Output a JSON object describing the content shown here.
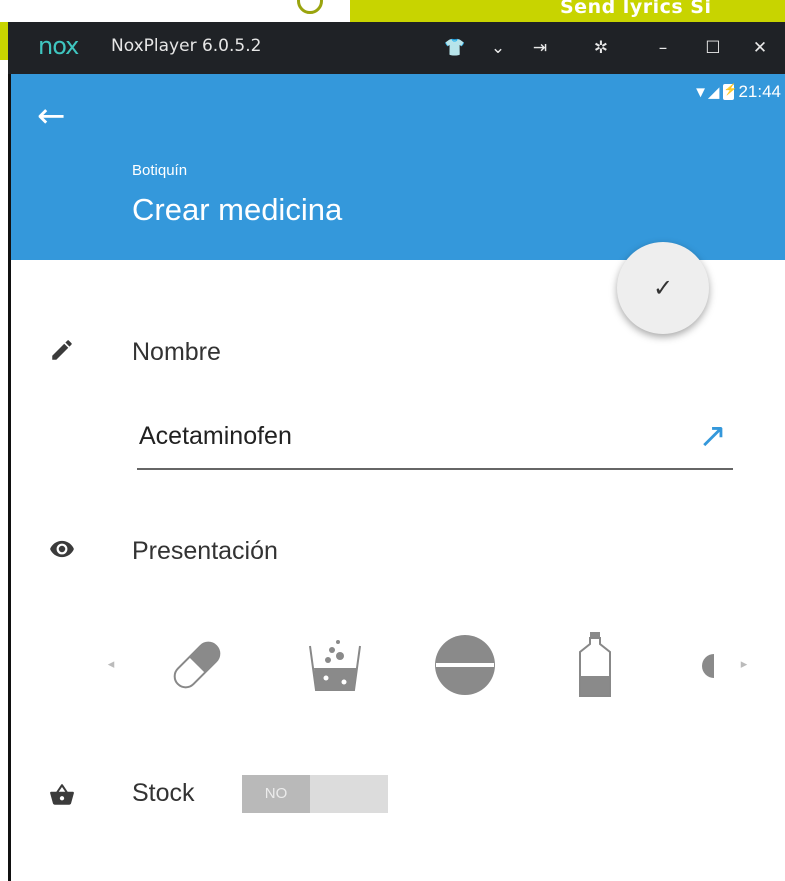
{
  "desktop": {
    "banner_text": "Send lyrics   Si"
  },
  "window": {
    "logo": "nox",
    "title": "NoxPlayer 6.0.5.2",
    "controls": [
      {
        "name": "skin-icon",
        "glyph": "👕"
      },
      {
        "name": "chevron-down-icon",
        "glyph": "⌄"
      },
      {
        "name": "pin-icon",
        "glyph": "⇥"
      },
      {
        "name": "gear-icon",
        "glyph": "✲"
      },
      {
        "name": "minimize-icon",
        "glyph": "–"
      },
      {
        "name": "maximize-icon",
        "glyph": "☐"
      },
      {
        "name": "close-icon",
        "glyph": "✕"
      }
    ]
  },
  "status_bar": {
    "time": "21:44"
  },
  "app_bar": {
    "back_icon": "←",
    "subtitle": "Botiquín",
    "title": "Crear medicina",
    "colors": {
      "primary": "#3498db"
    }
  },
  "fab": {
    "icon": "✓"
  },
  "form": {
    "name": {
      "icon": "pencil-icon",
      "label": "Nombre",
      "value": "Acetaminofen",
      "link_icon": "↗"
    },
    "presentation": {
      "icon": "eye-icon",
      "label": "Presentación",
      "items": [
        "capsule",
        "effervescent",
        "tablet",
        "bottle",
        "partial-next"
      ]
    },
    "stock": {
      "icon": "basket-icon",
      "label": "Stock",
      "toggle_text": "NO",
      "enabled": false
    }
  }
}
